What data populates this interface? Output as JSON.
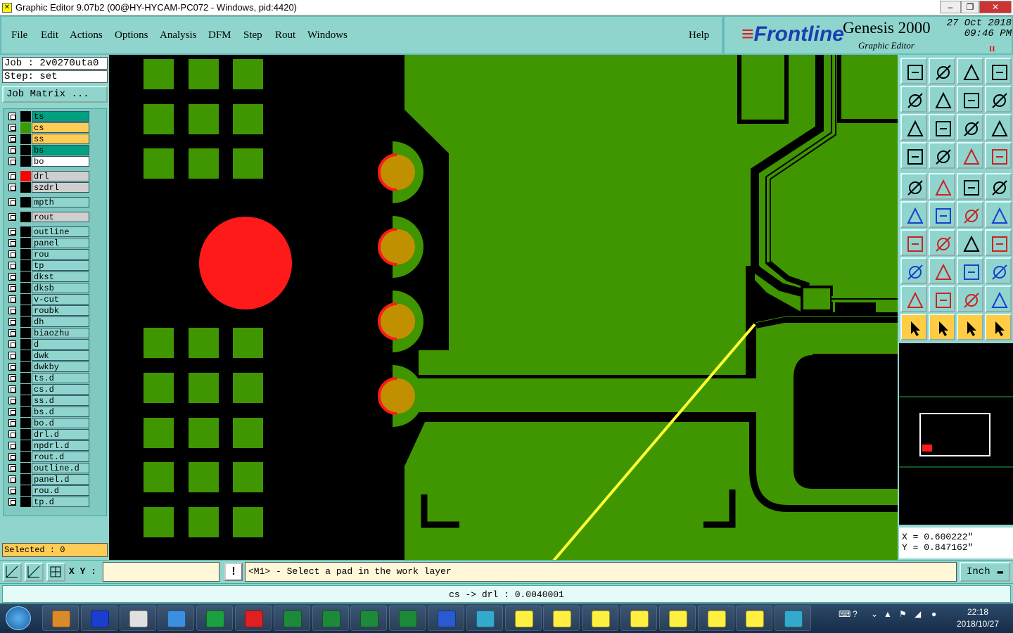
{
  "window": {
    "title": "Graphic Editor 9.07b2 (00@HY-HYCAM-PC072 - Windows, pid:4420)"
  },
  "menu": {
    "items": [
      "File",
      "Edit",
      "Actions",
      "Options",
      "Analysis",
      "DFM",
      "Step",
      "Rout",
      "Windows"
    ],
    "help": "Help"
  },
  "brand": {
    "logo": "Frontline",
    "product": "Genesis 2000",
    "subtitle": "Graphic Editor",
    "date": "27 Oct 2018",
    "time": "09:46 PM",
    "indicator": "II"
  },
  "job": {
    "job_label": "Job : 2v0270uta0",
    "step_label": "Step: set",
    "matrix_button": "Job Matrix ..."
  },
  "layers": [
    {
      "name": "ts",
      "color": "#00a080",
      "swatch": "#000"
    },
    {
      "name": "cs",
      "color": "#ffcc55",
      "swatch": "#3a9a00"
    },
    {
      "name": "ss",
      "color": "#ffcc55",
      "swatch": "#000"
    },
    {
      "name": "bs",
      "color": "#00a080",
      "swatch": "#000"
    },
    {
      "name": "bo",
      "color": "#ffffff",
      "swatch": "#000"
    },
    {
      "name": "drl",
      "color": "#cfcfcf",
      "swatch": "#ff0000",
      "sel": true
    },
    {
      "name": "szdrl",
      "color": "#cfcfcf",
      "swatch": "#000"
    },
    {
      "name": "mpth",
      "color": "#8fd5cd",
      "swatch": "#000"
    },
    {
      "name": "rout",
      "color": "#cfcfcf",
      "swatch": "#000"
    },
    {
      "name": "outline",
      "color": "#8fd5cd",
      "swatch": "#000"
    },
    {
      "name": "panel",
      "color": "#8fd5cd",
      "swatch": "#000"
    },
    {
      "name": "rou",
      "color": "#8fd5cd",
      "swatch": "#000"
    },
    {
      "name": "tp",
      "color": "#8fd5cd",
      "swatch": "#000"
    },
    {
      "name": "dkst",
      "color": "#8fd5cd",
      "swatch": "#000"
    },
    {
      "name": "dksb",
      "color": "#8fd5cd",
      "swatch": "#000"
    },
    {
      "name": "v-cut",
      "color": "#8fd5cd",
      "swatch": "#000"
    },
    {
      "name": "roubk",
      "color": "#8fd5cd",
      "swatch": "#000"
    },
    {
      "name": "dh",
      "color": "#8fd5cd",
      "swatch": "#000"
    },
    {
      "name": "biaozhu",
      "color": "#8fd5cd",
      "swatch": "#000"
    },
    {
      "name": "d",
      "color": "#8fd5cd",
      "swatch": "#000"
    },
    {
      "name": "dwk",
      "color": "#8fd5cd",
      "swatch": "#000"
    },
    {
      "name": "dwkby",
      "color": "#8fd5cd",
      "swatch": "#000"
    },
    {
      "name": "ts.d",
      "color": "#8fd5cd",
      "swatch": "#000"
    },
    {
      "name": "cs.d",
      "color": "#8fd5cd",
      "swatch": "#000"
    },
    {
      "name": "ss.d",
      "color": "#8fd5cd",
      "swatch": "#000"
    },
    {
      "name": "bs.d",
      "color": "#8fd5cd",
      "swatch": "#000"
    },
    {
      "name": "bo.d",
      "color": "#8fd5cd",
      "swatch": "#000"
    },
    {
      "name": "drl.d",
      "color": "#8fd5cd",
      "swatch": "#000"
    },
    {
      "name": "npdrl.d",
      "color": "#8fd5cd",
      "swatch": "#000"
    },
    {
      "name": "rout.d",
      "color": "#8fd5cd",
      "swatch": "#000"
    },
    {
      "name": "outline.d",
      "color": "#8fd5cd",
      "swatch": "#000"
    },
    {
      "name": "panel.d",
      "color": "#8fd5cd",
      "swatch": "#000"
    },
    {
      "name": "rou.d",
      "color": "#8fd5cd",
      "swatch": "#000"
    },
    {
      "name": "tp.d",
      "color": "#8fd5cd",
      "swatch": "#000"
    }
  ],
  "selected": "Selected : 0",
  "coords": {
    "x": "X = 0.600222\"",
    "y": "Y = 0.847162\""
  },
  "bottom": {
    "xy_label": "X Y :",
    "xy_value": "",
    "prompt": "<M1> - Select a pad in the work layer",
    "units": "Inch"
  },
  "status": "cs -> drl : 0.0040001",
  "clock": {
    "time": "22:18",
    "date": "2018/10/27"
  },
  "colors": {
    "copper": "#3f9600",
    "pad": "#c09000",
    "drill": "#ff1a1a",
    "annotation": "#ffff33",
    "panel_bg": "#8fd5cd"
  }
}
